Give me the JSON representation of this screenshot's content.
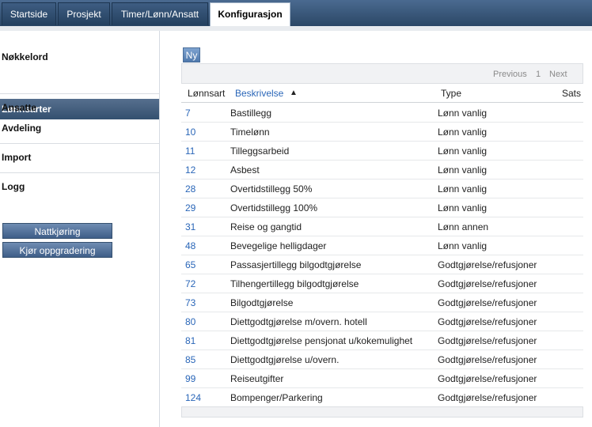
{
  "tabs": [
    {
      "label": "Startside"
    },
    {
      "label": "Prosjekt"
    },
    {
      "label": "Timer/Lønn/Ansatt"
    },
    {
      "label": "Konfigurasjon"
    }
  ],
  "sidebar": {
    "items": [
      "Nøkkelord",
      "Lønnsarter",
      "Ansatte",
      "Avdeling",
      "Import",
      "Logg"
    ],
    "buttons": [
      "Nattkjøring",
      "Kjør oppgradering"
    ]
  },
  "main": {
    "new_button": "Ny",
    "pager": {
      "previous": "Previous",
      "page": "1",
      "next": "Next"
    },
    "columns": [
      "Lønnsart",
      "Beskrivelse",
      "Type",
      "Sats"
    ],
    "sort_icon": "▲",
    "rows": [
      [
        "7",
        "Bastillegg",
        "Lønn vanlig"
      ],
      [
        "10",
        "Timelønn",
        "Lønn vanlig"
      ],
      [
        "11",
        "Tilleggsarbeid",
        "Lønn vanlig"
      ],
      [
        "12",
        "Asbest",
        "Lønn vanlig"
      ],
      [
        "28",
        "Overtidstillegg 50%",
        "Lønn vanlig"
      ],
      [
        "29",
        "Overtidstillegg 100%",
        "Lønn vanlig"
      ],
      [
        "31",
        "Reise og gangtid",
        "Lønn annen"
      ],
      [
        "48",
        "Bevegelige helligdager",
        "Lønn vanlig"
      ],
      [
        "65",
        "Passasjertillegg bilgodtgjørelse",
        "Godtgjørelse/refusjoner"
      ],
      [
        "72",
        "Tilhengertillegg bilgodtgjørelse",
        "Godtgjørelse/refusjoner"
      ],
      [
        "73",
        "Bilgodtgjørelse",
        "Godtgjørelse/refusjoner"
      ],
      [
        "80",
        "Diettgodtgjørelse m/overn. hotell",
        "Godtgjørelse/refusjoner"
      ],
      [
        "81",
        "Diettgodtgjørelse pensjonat u/kokemulighet",
        "Godtgjørelse/refusjoner"
      ],
      [
        "85",
        "Diettgodtgjørelse u/overn.",
        "Godtgjørelse/refusjoner"
      ],
      [
        "99",
        "Reiseutgifter",
        "Godtgjørelse/refusjoner"
      ],
      [
        "124",
        "Bompenger/Parkering",
        "Godtgjørelse/refusjoner"
      ]
    ]
  }
}
